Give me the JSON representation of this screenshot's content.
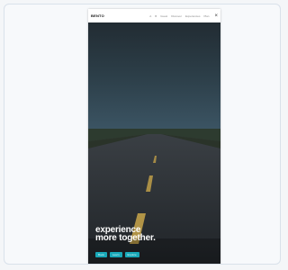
{
  "header": {
    "brand": "BENTO",
    "nav": [
      "A",
      "B",
      "Guest",
      "Discover",
      "Experiences",
      "Plan",
      "Stay"
    ],
    "close_icon": "close-icon"
  },
  "hero": {
    "tagline_line1": "experience",
    "tagline_line2": "more together.",
    "buttons": [
      "Book",
      "Learn",
      "Explore"
    ]
  },
  "colors": {
    "sky": "#1b2a33",
    "road": "#2a2e31",
    "accent": "#18a8b8",
    "lane": "#c9a64a"
  }
}
